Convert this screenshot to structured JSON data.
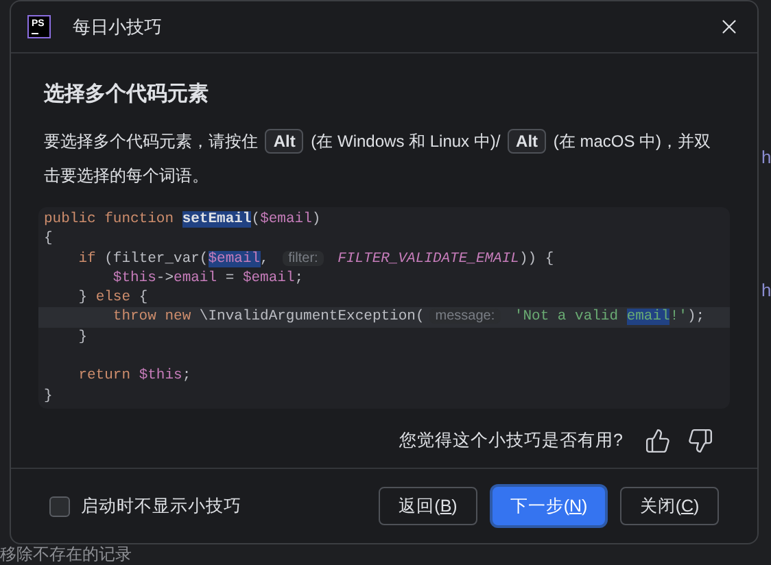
{
  "background": {
    "side_texts": [
      "h",
      "h"
    ],
    "bottom_text": "移除不存在的记录"
  },
  "window": {
    "app_icon": "PS",
    "title": "每日小技巧"
  },
  "tip": {
    "heading": "选择多个代码元素",
    "paragraph": [
      {
        "kind": "text",
        "text": "要选择多个代码元素，请按住 "
      },
      {
        "kind": "key",
        "text": "Alt"
      },
      {
        "kind": "text",
        "text": " (在 Windows 和 Linux 中)/ "
      },
      {
        "kind": "key",
        "text": "Alt"
      },
      {
        "kind": "text",
        "text": " (在 macOS 中)，并双击要选择的每个词语。"
      }
    ],
    "code": [
      {
        "current": false,
        "tokens": [
          {
            "kind": "kw",
            "text": "public function "
          },
          {
            "kind": "fn",
            "text": "setEmail",
            "selected": true
          },
          {
            "kind": "plain",
            "text": "("
          },
          {
            "kind": "var",
            "text": "$email"
          },
          {
            "kind": "plain",
            "text": ")"
          }
        ]
      },
      {
        "current": false,
        "tokens": [
          {
            "kind": "plain",
            "text": "{"
          }
        ]
      },
      {
        "current": false,
        "tokens": [
          {
            "kind": "kw",
            "text": "    if "
          },
          {
            "kind": "plain",
            "text": "(filter_var("
          },
          {
            "kind": "var",
            "text": "$email",
            "selected": true
          },
          {
            "kind": "plain",
            "text": ", "
          },
          {
            "kind": "hint",
            "text": "filter:"
          },
          {
            "kind": "const",
            "text": " FILTER_VALIDATE_EMAIL"
          },
          {
            "kind": "plain",
            "text": ")) {"
          }
        ]
      },
      {
        "current": false,
        "tokens": [
          {
            "kind": "var",
            "text": "        $this"
          },
          {
            "kind": "plain",
            "text": "->"
          },
          {
            "kind": "var",
            "text": "email"
          },
          {
            "kind": "plain",
            "text": " = "
          },
          {
            "kind": "var",
            "text": "$email"
          },
          {
            "kind": "plain",
            "text": ";"
          }
        ]
      },
      {
        "current": false,
        "tokens": [
          {
            "kind": "plain",
            "text": "    } "
          },
          {
            "kind": "kw",
            "text": "else"
          },
          {
            "kind": "plain",
            "text": " {"
          }
        ]
      },
      {
        "current": true,
        "tokens": [
          {
            "kind": "kw",
            "text": "        throw new "
          },
          {
            "kind": "plain",
            "text": "\\InvalidArgumentException("
          },
          {
            "kind": "hint",
            "text": "message:"
          },
          {
            "kind": "str",
            "text": " 'Not a valid "
          },
          {
            "kind": "str",
            "text": "email",
            "selected": true
          },
          {
            "kind": "str",
            "text": "!'"
          },
          {
            "kind": "plain",
            "text": ");"
          }
        ]
      },
      {
        "current": false,
        "tokens": [
          {
            "kind": "plain",
            "text": "    }"
          }
        ]
      },
      {
        "current": false
      },
      {
        "current": false,
        "tokens": [
          {
            "kind": "kw",
            "text": "    return "
          },
          {
            "kind": "var",
            "text": "$this"
          },
          {
            "kind": "plain",
            "text": ";"
          }
        ]
      },
      {
        "current": false,
        "tokens": [
          {
            "kind": "plain",
            "text": "}"
          }
        ]
      }
    ]
  },
  "feedback": {
    "question": "您觉得这个小技巧是否有用?"
  },
  "footer": {
    "dont_show": {
      "label": "启动时不显示小技巧",
      "checked": false
    },
    "buttons": [
      {
        "parts": [
          "返回(",
          "B",
          ")"
        ],
        "primary": false
      },
      {
        "parts": [
          "下一步(",
          "N",
          ")"
        ],
        "primary": true
      },
      {
        "parts": [
          "关闭(",
          "C",
          ")"
        ],
        "primary": false
      }
    ]
  }
}
